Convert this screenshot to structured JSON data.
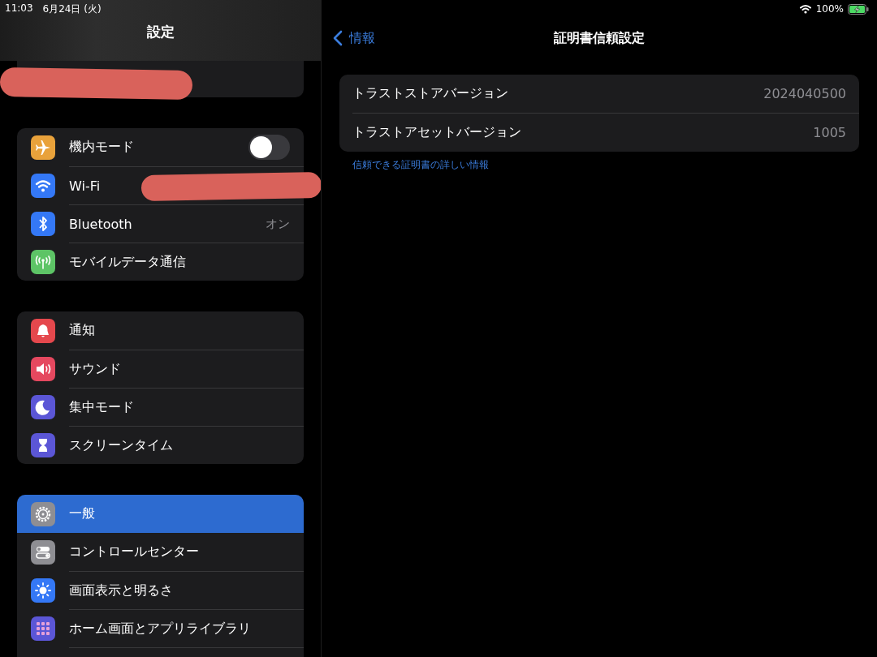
{
  "status_bar": {
    "time": "11:03",
    "date": "6月24日 (火)",
    "battery": "100%",
    "charging": true
  },
  "sidebar": {
    "title": "設定",
    "profile": {
      "redacted": true
    },
    "groups": [
      {
        "items": [
          {
            "label": "機内モード",
            "color": "#e9a23b",
            "kind": "toggle",
            "on": false,
            "selected": false
          },
          {
            "label": "Wi-Fi",
            "color": "#3478f6",
            "kind": "redacted",
            "selected": false
          },
          {
            "label": "Bluetooth",
            "color": "#3478f6",
            "kind": "value",
            "value": "オン",
            "selected": false
          },
          {
            "label": "モバイルデータ通信",
            "color": "#5dc466",
            "kind": "plain",
            "selected": false
          }
        ]
      },
      {
        "items": [
          {
            "label": "通知",
            "color": "#e5484d",
            "kind": "plain",
            "selected": false
          },
          {
            "label": "サウンド",
            "color": "#e5485f",
            "kind": "plain",
            "selected": false
          },
          {
            "label": "集中モード",
            "color": "#5b56d6",
            "kind": "plain",
            "selected": false
          },
          {
            "label": "スクリーンタイム",
            "color": "#5b56d6",
            "kind": "plain",
            "selected": false
          }
        ]
      },
      {
        "items": [
          {
            "label": "一般",
            "color": "#8e8e93",
            "kind": "plain",
            "selected": true
          },
          {
            "label": "コントロールセンター",
            "color": "#8e8e93",
            "kind": "plain",
            "selected": false
          },
          {
            "label": "画面表示と明るさ",
            "color": "#3478f6",
            "kind": "plain",
            "selected": false
          },
          {
            "label": "ホーム画面とアプリライブラリ",
            "color": "#5b56d6",
            "kind": "plain",
            "selected": false
          }
        ]
      }
    ]
  },
  "detail": {
    "back": "情報",
    "title": "証明書信頼設定",
    "rows": [
      {
        "label": "トラストストアバージョン",
        "value": "2024040500"
      },
      {
        "label": "トラストアセットバージョン",
        "value": "1005"
      }
    ],
    "link": "信頼できる証明書の詳しい情報"
  }
}
